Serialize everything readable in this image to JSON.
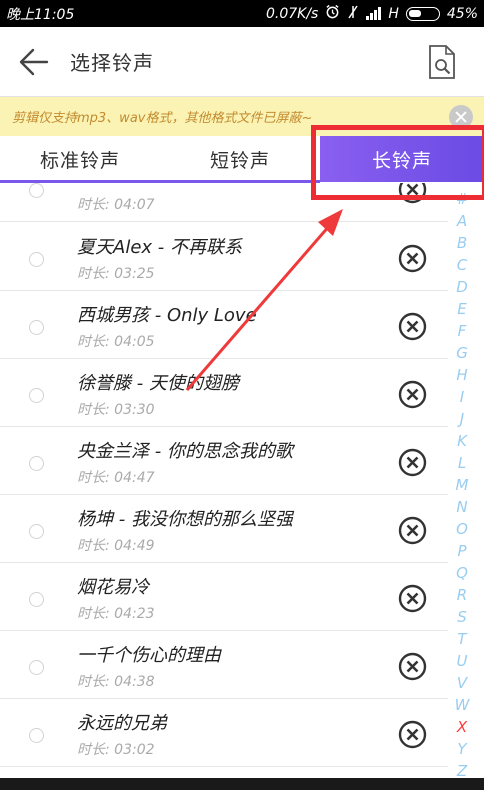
{
  "status_bar": {
    "time": "晚上11:05",
    "speed": "0.07K/s",
    "network": "H",
    "battery": "45%",
    "battery_level": 0.45
  },
  "header": {
    "title": "选择铃声",
    "back_icon": "arrow-left-icon",
    "search_icon": "file-search-icon"
  },
  "notice": {
    "text": "剪辑仅支持mp3、wav格式，其他格式文件已屏蔽~"
  },
  "tabs": [
    {
      "label": "标准铃声",
      "selected": false
    },
    {
      "label": "短铃声",
      "selected": false
    },
    {
      "label": "长铃声",
      "selected": true
    }
  ],
  "colors": {
    "accent": "#7a58ec",
    "highlight": "#ee2c33",
    "notice_bg": "#fbf3b4",
    "alphabet": "#99cdf0",
    "alphabet_active": "#ff3a3a"
  },
  "songs": [
    {
      "title": "",
      "duration": "时长: 04:07"
    },
    {
      "title": "夏天Alex - 不再联系",
      "duration": "时长: 03:25"
    },
    {
      "title": "西城男孩 - Only Love",
      "duration": "时长: 04:05"
    },
    {
      "title": "徐誉滕 - 天使的翅膀",
      "duration": "时长: 03:30"
    },
    {
      "title": "央金兰泽 - 你的思念我的歌",
      "duration": "时长: 04:47"
    },
    {
      "title": "杨坤 - 我没你想的那么坚强",
      "duration": "时长: 04:49"
    },
    {
      "title": "烟花易冷",
      "duration": "时长: 04:23"
    },
    {
      "title": "一千个伤心的理由",
      "duration": "时长: 04:38"
    },
    {
      "title": "永远的兄弟",
      "duration": "时长: 03:02"
    }
  ],
  "alphabet": [
    "#",
    "A",
    "B",
    "C",
    "D",
    "E",
    "F",
    "G",
    "H",
    "I",
    "J",
    "K",
    "L",
    "M",
    "N",
    "O",
    "P",
    "Q",
    "R",
    "S",
    "T",
    "U",
    "V",
    "W",
    "X",
    "Y",
    "Z"
  ],
  "alphabet_active": "X"
}
